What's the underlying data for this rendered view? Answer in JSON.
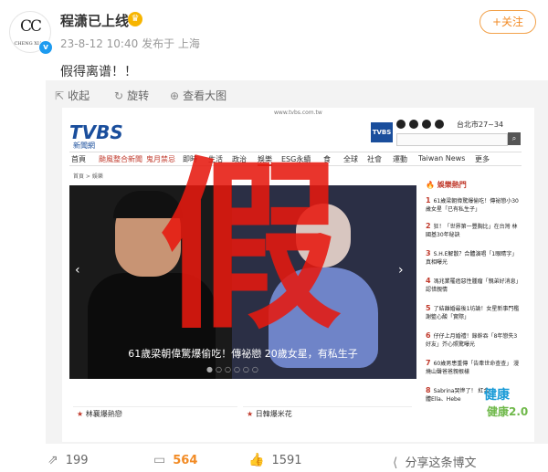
{
  "post": {
    "username": "程潇已上线",
    "avatar_text": "CC",
    "avatar_sub": "CHENG XIAO",
    "date": "23-8-12 10:40",
    "published_in": "发布于 上海",
    "follow_label": "+关注",
    "text": "假得离谱！！"
  },
  "image_toolbar": {
    "collapse_label": "收起",
    "rotate_label": "旋转",
    "view_large_label": "查看大图"
  },
  "screenshot": {
    "url": "www.tvbs.com.tw",
    "logo": "TVBS",
    "logo_sub": "新聞網",
    "weather": "台北市27~34",
    "nav": [
      "首頁",
      "颱風整合新聞",
      "鬼月禁忌",
      "即時",
      "生活",
      "政治",
      "娛樂",
      "ESG永續",
      "食",
      "全球",
      "社會",
      "運動",
      "Taiwan News",
      "更多"
    ],
    "breadcrumb": "首頁 > 娛樂",
    "hero_caption": "61歲梁朝偉驚爆偷吃！傳祕戀 20歲女星，有私生子",
    "stamp": "假",
    "sidebar_title": "娛樂熱門",
    "sidebar_items": [
      {
        "num": "1",
        "text": "61歲梁朝偉驚爆偷吃！傳祕戀小30歲女星「已有私生子」"
      },
      {
        "num": "2",
        "text": "狂！「世界第一豐胸比」在台灣 林國基30年秘訣"
      },
      {
        "num": "3",
        "text": "S.H.E解散？合體演唱「1眼睛字」 真相曝光"
      },
      {
        "num": "4",
        "text": "馮兆業罹癌惡性腫瘤「親弟好消息」 認惜親情"
      },
      {
        "num": "5",
        "text": "了結離婚最後1坊論！女星新事門檻 謝籃心酸「實際」"
      },
      {
        "num": "6",
        "text": "仔仔上月婚禮！錄幹吞「8年戀失3好友」芥心照驚曝光"
      },
      {
        "num": "7",
        "text": "60歲男患重傳「告牽世命查查」 漫燒山聲爸爸親根樣"
      },
      {
        "num": "8",
        "text": "Sabrina哭慘了！ 紅合體Ella、Hebe"
      }
    ],
    "card_left": "林襄爆熱戀",
    "card_right": "日韓爆米花",
    "health_logo": "健康",
    "health_sub": "健康2.0"
  },
  "footer": {
    "repost_count": "199",
    "comment_count": "564",
    "like_count": "1591",
    "share_label": "分享这条博文"
  },
  "colors": {
    "accent": "#f28b25",
    "stamp": "#e6190f",
    "tvbs_blue": "#1a4e9c"
  }
}
